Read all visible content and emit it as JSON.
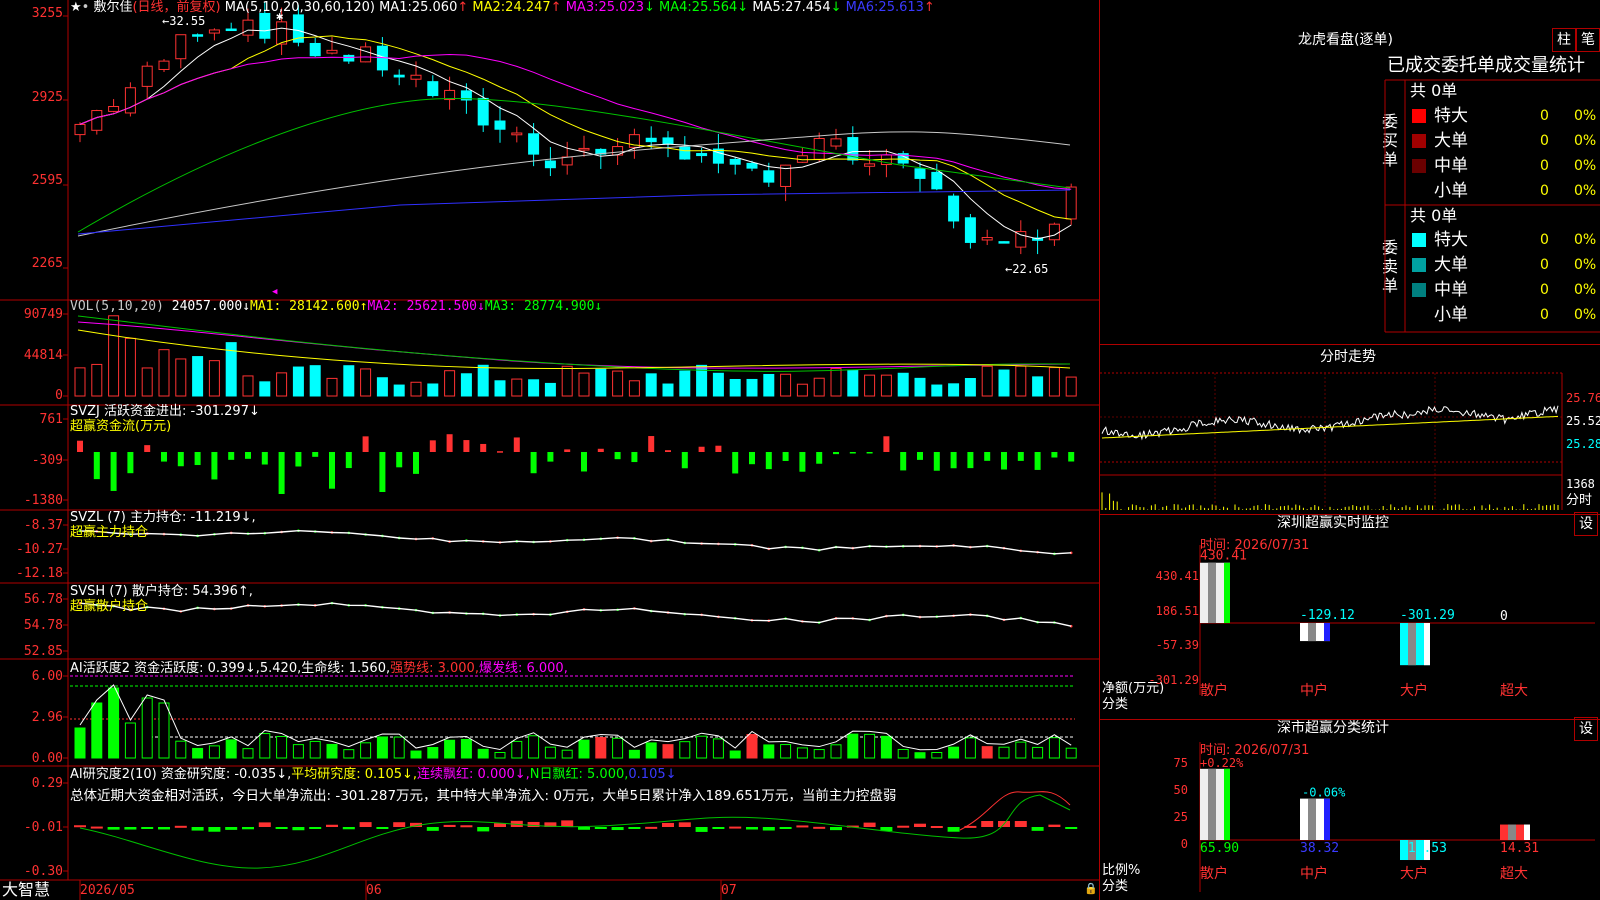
{
  "app": {
    "brand": "大智慧"
  },
  "kline": {
    "name": "敷尔佳",
    "mode": "(日线，前复权)",
    "ma_label": "MA(5,10,20,30,60,120)",
    "ma": [
      {
        "k": "MA1:",
        "v": "25.060",
        "a": "↑"
      },
      {
        "k": "MA2:",
        "v": "24.247",
        "a": "↑"
      },
      {
        "k": "MA3:",
        "v": "25.023",
        "a": "↓"
      },
      {
        "k": "MA4:",
        "v": "25.564",
        "a": "↓"
      },
      {
        "k": "MA5:",
        "v": "27.454",
        "a": "↓"
      },
      {
        "k": "MA6:",
        "v": "25.613",
        "a": "↑"
      }
    ],
    "high_label": "←32.55",
    "low_label": "←22.65",
    "ylabels": [
      "3255",
      "2925",
      "2595",
      "2265"
    ],
    "date_labels": [
      "2026/05",
      "06",
      "07"
    ]
  },
  "vol": {
    "title": "VOL(5,10,20)",
    "v": "24057.000↓",
    "ma1": "MA1: 28142.600↑",
    "ma2": "MA2: 25621.500↓",
    "ma3": "MA3: 28774.900↓",
    "ylabels": [
      "90749",
      "44814",
      "0"
    ]
  },
  "svzj": {
    "title": "SVZJ  活跃资金进出: -301.297↓",
    "sub": "超赢资金流(万元)",
    "ylabels": [
      "761",
      "-309",
      "-1380"
    ]
  },
  "svzl": {
    "title": "SVZL (7) 主力持仓: -11.219↓,",
    "sub": "超赢主力持仓",
    "ylabels": [
      "-8.37",
      "-10.27",
      "-12.18"
    ]
  },
  "svsh": {
    "title": "SVSH (7) 散户持仓: 54.396↑,",
    "sub": "超赢散户持仓",
    "ylabels": [
      "56.78",
      "54.78",
      "52.85"
    ]
  },
  "ai1": {
    "t1": "AI活跃度2 资金活跃度: 0.399↓,5.420,生命线: 1.560,",
    "t2": "强势线: 3.000,",
    "t3": "爆发线: 6.000,",
    "ylabels": [
      "6.00",
      "2.96",
      "0.00"
    ]
  },
  "ai2": {
    "t1": "AI研究度2(10) 资金研究度: -0.035↓,",
    "t2": "平均研究度: 0.105↓,",
    "t3": "连续飘红: 0.000↓,",
    "t4": "N日飘红: 5.000,",
    "t5": "0.105↓",
    "summary": "总体近期大资金相对活跃，今日大单净流出: -301.287万元，其中特大单净流入: 0万元，大单5日累计净入189.651万元，当前主力控盘弱",
    "ylabels": [
      "0.29",
      "-0.01",
      "-0.30"
    ]
  },
  "lhb": {
    "title": "龙虎看盘(逐单)",
    "btn1": "柱",
    "btn2": "笔",
    "subtitle": "已成交委托单成交量统计",
    "buy_label": "委买单",
    "sell_label": "委卖单",
    "buy_total": "共 0单",
    "sell_total": "共 0单",
    "buy_rows": [
      {
        "name": "特大",
        "n": "0",
        "p": "0%",
        "color": "#ff0000"
      },
      {
        "name": "大单",
        "n": "0",
        "p": "0%",
        "color": "#a00000"
      },
      {
        "name": "中单",
        "n": "0",
        "p": "0%",
        "color": "#6a0000"
      },
      {
        "name": "小单",
        "n": "0",
        "p": "0%",
        "color": ""
      }
    ],
    "sell_rows": [
      {
        "name": "特大",
        "n": "0",
        "p": "0%",
        "color": "#00ffff"
      },
      {
        "name": "大单",
        "n": "0",
        "p": "0%",
        "color": "#00a0a0"
      },
      {
        "name": "中单",
        "n": "0",
        "p": "0%",
        "color": "#008080"
      },
      {
        "name": "小单",
        "n": "0",
        "p": "0%",
        "color": ""
      }
    ]
  },
  "fenshi": {
    "title": "分时走势",
    "ylabels": [
      "25.76",
      "25.52",
      "25.28"
    ],
    "vol_label": "1368",
    "vol_unit": "分时"
  },
  "szjk": {
    "title": "深圳超赢实时监控",
    "btn": "设",
    "time": "时间: 2026/07/31",
    "ylabels": [
      "430.41",
      "186.51",
      "-57.39",
      "-301.29"
    ],
    "ylabel_unit": "净额(万元)",
    "xlabel": "分类",
    "values": [
      {
        "cat": "散户",
        "v": 430.41,
        "label": "430.41"
      },
      {
        "cat": "中户",
        "v": -129.12,
        "label": "-129.12"
      },
      {
        "cat": "大户",
        "v": -301.29,
        "label": "-301.29"
      },
      {
        "cat": "超大",
        "v": 0,
        "label": "0"
      }
    ]
  },
  "ssfl": {
    "title": "深市超赢分类统计",
    "btn": "设",
    "time": "时间: 2026/07/31",
    "ylabels": [
      "75",
      "50",
      "25",
      "0"
    ],
    "ylabel_unit": "比例%",
    "xlabel": "分类",
    "values": [
      {
        "cat": "散户",
        "v": 65.9,
        "pct": "+0.22%",
        "label": "65.90"
      },
      {
        "cat": "中户",
        "v": 38.32,
        "pct": "-0.06%",
        "label": "38.32"
      },
      {
        "cat": "大户",
        "v": -18.53,
        "pct": "",
        "label": "-18.53"
      },
      {
        "cat": "超大",
        "v": 14.31,
        "pct": "",
        "label": "14.31"
      }
    ]
  }
}
